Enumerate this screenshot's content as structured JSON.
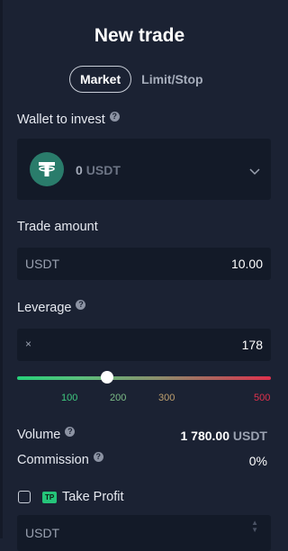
{
  "title": "New trade",
  "tabs": {
    "market": "Market",
    "limit_stop": "Limit/Stop"
  },
  "wallet": {
    "label": "Wallet to invest",
    "amount": "0",
    "currency": "USDT"
  },
  "trade_amount": {
    "label": "Trade amount",
    "currency": "USDT",
    "value": "10.00"
  },
  "leverage": {
    "label": "Leverage",
    "multiplier_symbol": "×",
    "value": "178",
    "slider_level_fraction": 0.356,
    "ticks": [
      "100",
      "200",
      "300",
      "500"
    ]
  },
  "volume": {
    "label": "Volume",
    "value": "1 780.00",
    "currency": "USDT"
  },
  "commission": {
    "label": "Commission",
    "value": "0%"
  },
  "take_profit": {
    "badge": "TP",
    "label": "Take Profit",
    "field_currency": "USDT"
  },
  "colors": {
    "background": "#1b2233",
    "input_bg": "#131a28",
    "token_green": "#2a7c6b",
    "slider_start": "#27d17a",
    "slider_end": "#e0314d",
    "tp_badge": "#25c47a"
  },
  "icons": {
    "help": "help-icon",
    "token": "tether-icon",
    "dropdown": "chevron-down-icon",
    "stepper": "stepper-icon"
  }
}
